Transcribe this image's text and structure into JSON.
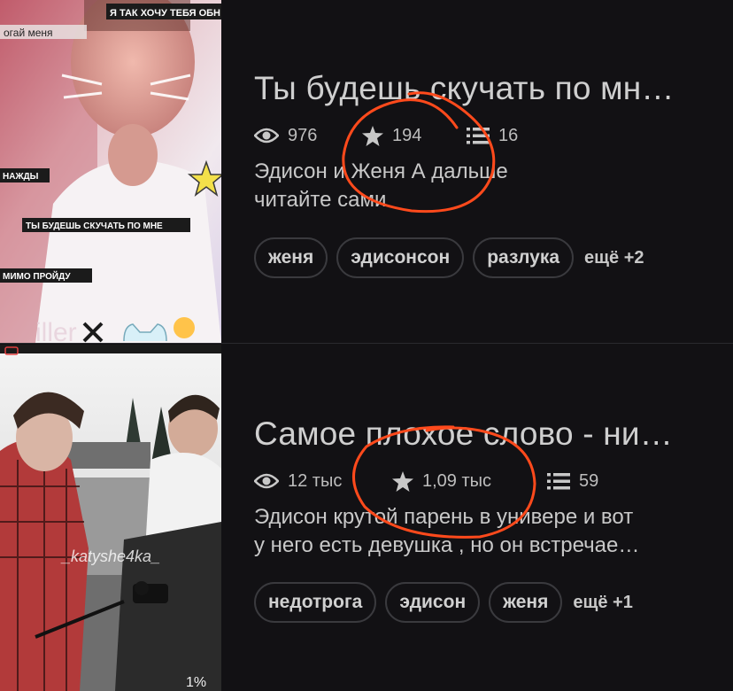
{
  "colors": {
    "background": "#121114",
    "text": "#cfcfcf",
    "tag_border": "#3a3a3e",
    "annotation": "#ff4a1c"
  },
  "stories": [
    {
      "cover": {
        "captions": [
          "Я ТАК ХОЧУ ТЕБЯ ОБН",
          "огай меня",
          "НАЖДЫ",
          "ТЫ БУДЕШЬ СКУЧАТЬ ПО МНЕ",
          "МИМО ПРОЙДУ",
          "iller"
        ]
      },
      "title": "Ты будешь скучать по мн…",
      "views_icon": "eye-icon",
      "views": "976",
      "stars_icon": "star-icon",
      "stars": "194",
      "lists_icon": "list-icon",
      "lists": "16",
      "description_lines": [
        "Эдисон и Женя  А дальше",
        "читайте сами"
      ],
      "tags": [
        "женя",
        "эдисонсон",
        "разлука"
      ],
      "more": "ещё +2"
    },
    {
      "cover": {
        "captions": [
          "_katyshe4ka_",
          "1%"
        ]
      },
      "title": "Самое плохое слово - ни…",
      "views_icon": "eye-icon",
      "views": "12 тыс",
      "stars_icon": "star-icon",
      "stars": "1,09 тыс",
      "lists_icon": "list-icon",
      "lists": "59",
      "description_lines": [
        "Эдисон крутой парень в универе и вот",
        "у него есть девушка , но он встречае…"
      ],
      "tags": [
        "недотрога",
        "эдисон",
        "женя"
      ],
      "more": "ещё +1"
    }
  ]
}
